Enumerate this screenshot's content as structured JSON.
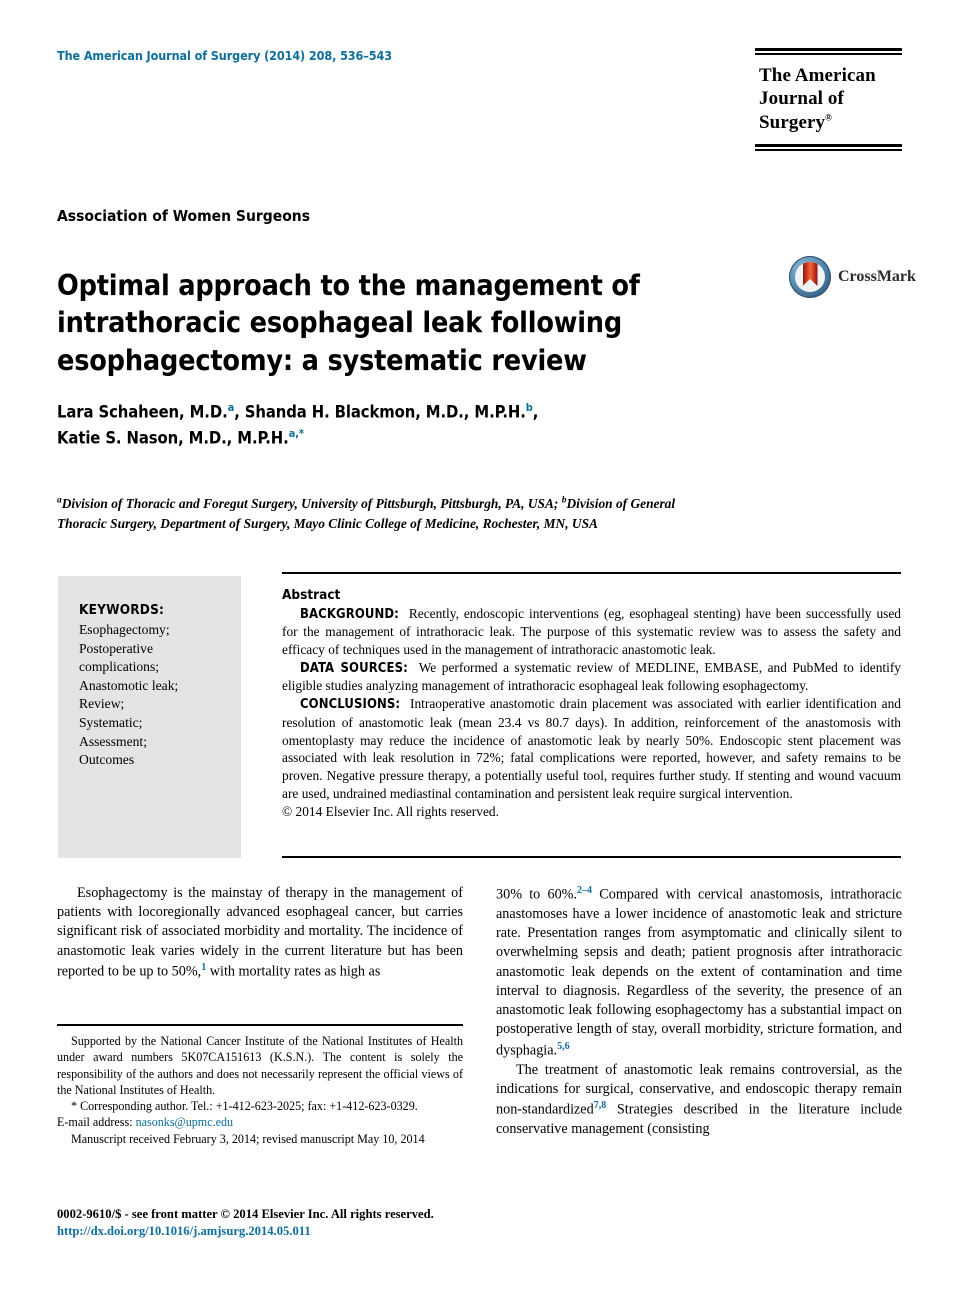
{
  "header": {
    "running_head": "The American Journal of Surgery (2014) 208, 536–543",
    "accent_color": "#0e6e9c",
    "logo_line1": "The American",
    "logo_line2": "Journal of Surgery",
    "logo_registered": "®"
  },
  "article": {
    "kicker": "Association of Women Surgeons",
    "title": "Optimal approach to the management of intrathoracic esophageal leak following esophagectomy: a systematic review",
    "crossmark_label": "CrossMark",
    "authors_line1": "Lara Schaheen, M.D.",
    "authors_line1_sup1": "a",
    "authors_line1_mid": ", Shanda H. Blackmon, M.D., M.P.H.",
    "authors_line1_sup2": "b",
    "authors_line1_end": ",",
    "authors_line2": "Katie S. Nason, M.D., M.P.H.",
    "authors_line2_sup": "a,",
    "authors_line2_star": "*",
    "affiliation_a_marker": "a",
    "affiliation_a": "Division of Thoracic and Foregut Surgery, University of Pittsburgh, Pittsburgh, PA, USA; ",
    "affiliation_b_marker": "b",
    "affiliation_b": "Division of General Thoracic Surgery, Department of Surgery, Mayo Clinic College of Medicine, Rochester, MN, USA"
  },
  "keywords": {
    "heading": "KEYWORDS:",
    "items_text": "Esophagectomy;\nPostoperative complications;\nAnastomotic leak;\nReview;\nSystematic;\nAssessment;\nOutcomes",
    "items": [
      "Esophagectomy;",
      "Postoperative complications;",
      "Anastomotic leak;",
      "Review;",
      "Systematic;",
      "Assessment;",
      "Outcomes"
    ],
    "background_color": "#e4e4e4"
  },
  "abstract": {
    "heading": "Abstract",
    "background_label": "BACKGROUND:",
    "background_text": "Recently, endoscopic interventions (eg, esophageal stenting) have been successfully used for the management of intrathoracic leak. The purpose of this systematic review was to assess the safety and efficacy of techniques used in the management of intrathoracic anastomotic leak.",
    "data_sources_label": "DATA SOURCES:",
    "data_sources_text": "We performed a systematic review of MEDLINE, EMBASE, and PubMed to identify eligible studies analyzing management of intrathoracic esophageal leak following esophagectomy.",
    "conclusions_label": "CONCLUSIONS:",
    "conclusions_text": "Intraoperative anastomotic drain placement was associated with earlier identification and resolution of anastomotic leak (mean 23.4 vs 80.7 days). In addition, reinforcement of the anastomosis with omentoplasty may reduce the incidence of anastomotic leak by nearly 50%. Endoscopic stent placement was associated with leak resolution in 72%; fatal complications were reported, however, and safety remains to be proven. Negative pressure therapy, a potentially useful tool, requires further study. If stenting and wound vacuum are used, undrained mediastinal contamination and persistent leak require surgical intervention.",
    "copyright": "© 2014 Elsevier Inc. All rights reserved."
  },
  "body": {
    "left_para1_a": "Esophagectomy is the mainstay of therapy in the management of patients with locoregionally advanced esophageal cancer, but carries significant risk of associated morbidity and mortality. The incidence of anastomotic leak varies widely in the current literature but has been reported to be up to 50%,",
    "left_para1_ref": "1",
    "left_para1_b": " with mortality rates as high as",
    "right_para1_a": "30% to 60%.",
    "right_para1_ref": "2–4",
    "right_para1_b": " Compared with cervical anastomosis, intrathoracic anastomoses have a lower incidence of anastomotic leak and stricture rate. Presentation ranges from asymptomatic and clinically silent to overwhelming sepsis and death; patient prognosis after intrathoracic anastomotic leak depends on the extent of contamination and time interval to diagnosis. Regardless of the severity, the presence of an anastomotic leak following esophagectomy has a substantial impact on postoperative length of stay, overall morbidity, stricture formation, and dysphagia.",
    "right_para1_ref2": "5,6",
    "right_para2_a": "The treatment of anastomotic leak remains controversial, as the indications for surgical, conservative, and endoscopic therapy remain non-standardized",
    "right_para2_ref": "7,8",
    "right_para2_b": " Strategies described in the literature include conservative management (consisting"
  },
  "footnotes": {
    "funding": "Supported by the National Cancer Institute of the National Institutes of Health under award numbers 5K07CA151613 (K.S.N.). The content is solely the responsibility of the authors and does not necessarily represent the official views of the National Institutes of Health.",
    "corresponding_marker": "*",
    "corresponding": " Corresponding author. Tel.: +1-412-623-2025; fax: +1-412-623-0329.",
    "email_label": "E-mail address: ",
    "email": "nasonks@upmc.edu",
    "manuscript_dates": "Manuscript received February 3, 2014; revised manuscript May 10, 2014"
  },
  "imprint": {
    "issn_line": "0002-9610/$ - see front matter © 2014 Elsevier Inc. All rights reserved.",
    "doi": "http://dx.doi.org/10.1016/j.amjsurg.2014.05.011"
  }
}
